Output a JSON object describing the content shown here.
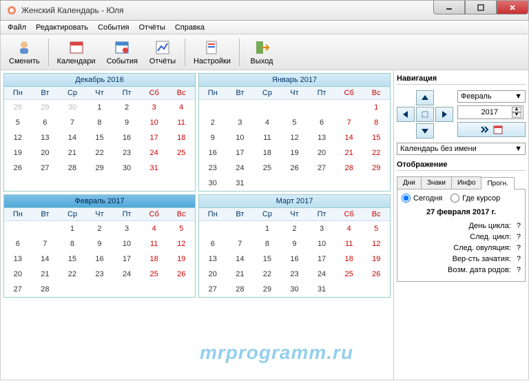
{
  "window": {
    "title": "Женский Календарь - Юля"
  },
  "menu": {
    "file": "Файл",
    "edit": "Редактировать",
    "events": "События",
    "reports": "Отчёты",
    "help": "Справка"
  },
  "toolbar": {
    "change": "Сменить",
    "calendars": "Календари",
    "events": "События",
    "reports": "Отчёты",
    "settings": "Настройки",
    "exit": "Выход"
  },
  "months": [
    {
      "title": "Декабрь  2016",
      "selected": false,
      "weeks": [
        [
          "28",
          "29",
          "30",
          "1",
          "2",
          "3",
          "4"
        ],
        [
          "5",
          "6",
          "7",
          "8",
          "9",
          "10",
          "11"
        ],
        [
          "12",
          "13",
          "14",
          "15",
          "16",
          "17",
          "18"
        ],
        [
          "19",
          "20",
          "21",
          "22",
          "23",
          "24",
          "25"
        ],
        [
          "26",
          "27",
          "28",
          "29",
          "30",
          "31",
          ""
        ],
        [
          "",
          "",
          "",
          "",
          "",
          "",
          ""
        ]
      ],
      "dim_before": 3
    },
    {
      "title": "Январь  2017",
      "selected": false,
      "weeks": [
        [
          "",
          "",
          "",
          "",
          "",
          "",
          "1"
        ],
        [
          "2",
          "3",
          "4",
          "5",
          "6",
          "7",
          "8"
        ],
        [
          "9",
          "10",
          "11",
          "12",
          "13",
          "14",
          "15"
        ],
        [
          "16",
          "17",
          "18",
          "19",
          "20",
          "21",
          "22"
        ],
        [
          "23",
          "24",
          "25",
          "26",
          "27",
          "28",
          "29"
        ],
        [
          "30",
          "31",
          "",
          "",
          "",
          "",
          ""
        ]
      ],
      "dim_before": 0
    },
    {
      "title": "Февраль  2017",
      "selected": true,
      "weeks": [
        [
          "",
          "",
          "1",
          "2",
          "3",
          "4",
          "5"
        ],
        [
          "6",
          "7",
          "8",
          "9",
          "10",
          "11",
          "12"
        ],
        [
          "13",
          "14",
          "15",
          "16",
          "17",
          "18",
          "19"
        ],
        [
          "20",
          "21",
          "22",
          "23",
          "24",
          "25",
          "26"
        ],
        [
          "27",
          "28",
          "",
          "",
          "",
          "",
          ""
        ]
      ],
      "dim_before": 0
    },
    {
      "title": "Март  2017",
      "selected": false,
      "weeks": [
        [
          "",
          "",
          "1",
          "2",
          "3",
          "4",
          "5"
        ],
        [
          "6",
          "7",
          "8",
          "9",
          "10",
          "11",
          "12"
        ],
        [
          "13",
          "14",
          "15",
          "16",
          "17",
          "18",
          "19"
        ],
        [
          "20",
          "21",
          "22",
          "23",
          "24",
          "25",
          "26"
        ],
        [
          "27",
          "28",
          "29",
          "30",
          "31",
          "",
          ""
        ]
      ],
      "dim_before": 0
    }
  ],
  "dow": [
    "Пн",
    "Вт",
    "Ср",
    "Чт",
    "Пт",
    "Сб",
    "Вс"
  ],
  "sidebar": {
    "nav_title": "Навигация",
    "month_select": "Февраль",
    "year": "2017",
    "cal_combo": "Календарь без имени",
    "disp_title": "Отображение",
    "tabs": {
      "days": "Дни",
      "signs": "Знаки",
      "info": "Инфо",
      "prog": "Прогн."
    },
    "radio_today": "Сегодня",
    "radio_cursor": "Где курсор",
    "date": "27 февраля 2017 г.",
    "rows": {
      "cycle_day": "День цикла:",
      "next_cycle": "След. цикл:",
      "next_ov": "След. овуляция:",
      "conc": "Вер-сть зачатия:",
      "birth": "Возм. дата родов:"
    },
    "q": "?"
  },
  "watermark": "mrprogramm.ru"
}
